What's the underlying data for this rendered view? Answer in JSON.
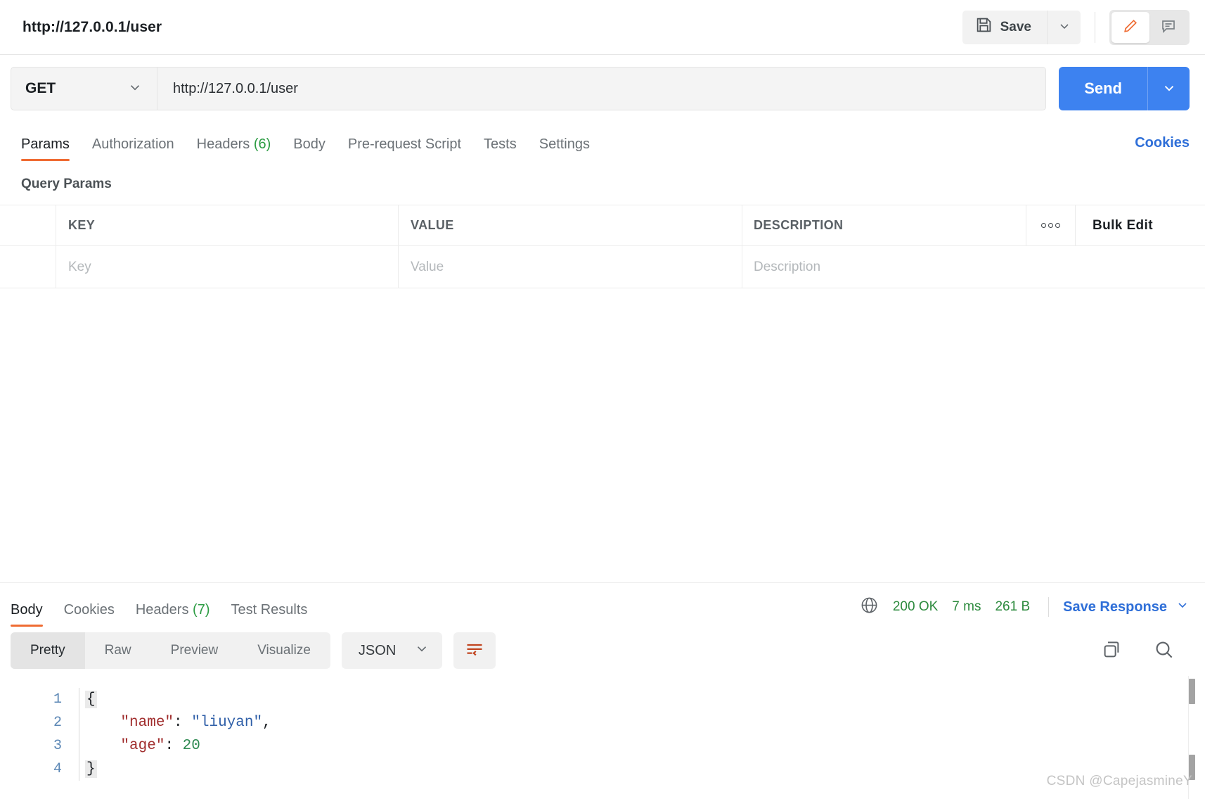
{
  "topbar": {
    "request_title": "http://127.0.0.1/user",
    "save_label": "Save",
    "save_icon": "floppy-disk-icon",
    "save_caret_icon": "chevron-down-icon",
    "edit_icon": "pencil-icon",
    "comment_icon": "comment-icon",
    "accent_orange": "#ef6c33"
  },
  "url_row": {
    "method": "GET",
    "method_caret_icon": "chevron-down-icon",
    "url": "http://127.0.0.1/user",
    "send_label": "Send",
    "send_caret_icon": "chevron-down-icon",
    "send_color": "#3d82f0"
  },
  "request_tabs": [
    {
      "label": "Params",
      "count": "",
      "active": true
    },
    {
      "label": "Authorization",
      "count": "",
      "active": false
    },
    {
      "label": "Headers",
      "count": "(6)",
      "active": false
    },
    {
      "label": "Body",
      "count": "",
      "active": false
    },
    {
      "label": "Pre-request Script",
      "count": "",
      "active": false
    },
    {
      "label": "Tests",
      "count": "",
      "active": false
    },
    {
      "label": "Settings",
      "count": "",
      "active": false
    }
  ],
  "cookies_link": "Cookies",
  "query_params": {
    "section_title": "Query Params",
    "columns": [
      "KEY",
      "VALUE",
      "DESCRIPTION"
    ],
    "bulk_edit_label": "Bulk Edit",
    "more_icon": "ellipsis-icon",
    "rows": [
      {
        "key_placeholder": "Key",
        "value_placeholder": "Value",
        "description_placeholder": "Description"
      }
    ]
  },
  "response": {
    "tabs": [
      {
        "label": "Body",
        "count": "",
        "active": true
      },
      {
        "label": "Cookies",
        "count": "",
        "active": false
      },
      {
        "label": "Headers",
        "count": "(7)",
        "active": false
      },
      {
        "label": "Test Results",
        "count": "",
        "active": false
      }
    ],
    "globe_icon": "globe-icon",
    "status": "200 OK",
    "time": "7 ms",
    "size": "261 B",
    "save_response_label": "Save Response",
    "save_response_caret_icon": "chevron-down-icon",
    "status_color": "#2c8a3d",
    "link_color": "#2f6fd8"
  },
  "view_bar": {
    "modes": [
      {
        "label": "Pretty",
        "active": true
      },
      {
        "label": "Raw",
        "active": false
      },
      {
        "label": "Preview",
        "active": false
      },
      {
        "label": "Visualize",
        "active": false
      }
    ],
    "format": "JSON",
    "format_caret_icon": "chevron-down-icon",
    "wrap_icon": "word-wrap-icon",
    "copy_icon": "copy-icon",
    "search_icon": "search-icon"
  },
  "code": {
    "lines": [
      {
        "num": "1",
        "brace": "{",
        "text": ""
      },
      {
        "num": "2",
        "brace": "",
        "text": "    \"name\": \"liuyan\","
      },
      {
        "num": "3",
        "brace": "",
        "text": "    \"age\": 20"
      },
      {
        "num": "4",
        "brace": "}",
        "text": ""
      }
    ],
    "line_numbers": [
      "1",
      "2",
      "3",
      "4"
    ],
    "raw": "{\n    \"name\": \"liuyan\",\n    \"age\": 20\n}",
    "tokens": {
      "l1_brace": "{",
      "l2_key": "\"name\"",
      "l2_colon": ": ",
      "l2_val": "\"liuyan\"",
      "l2_comma": ",",
      "l3_key": "\"age\"",
      "l3_colon": ": ",
      "l3_val": "20",
      "l4_brace": "}"
    }
  },
  "watermark": "CSDN @CapejasmineY"
}
